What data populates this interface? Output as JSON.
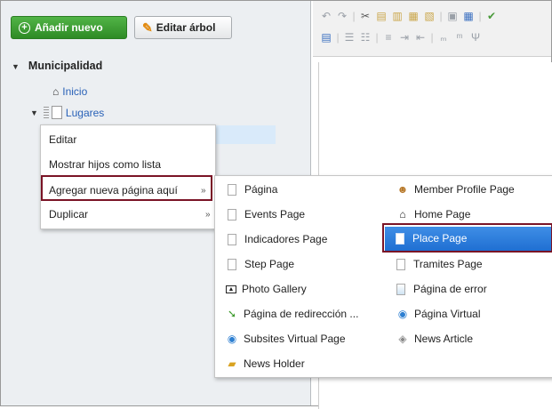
{
  "toolbar": {
    "add_label": "Añadir nuevo",
    "edit_tree_label": "Editar árbol"
  },
  "tree": {
    "root": "Municipalidad",
    "inicio": "Inicio",
    "lugares": "Lugares"
  },
  "context_menu": {
    "items": [
      {
        "label": "Editar",
        "submenu": false
      },
      {
        "label": "Mostrar hijos como lista",
        "submenu": false
      },
      {
        "label": "Agregar nueva página aquí",
        "submenu": true
      },
      {
        "label": "Duplicar",
        "submenu": true
      }
    ],
    "arrow": "»"
  },
  "submenu": {
    "col1": [
      {
        "label": "Página",
        "icon": "page-icon"
      },
      {
        "label": "Events Page",
        "icon": "page-icon"
      },
      {
        "label": "Indicadores Page",
        "icon": "page-icon"
      },
      {
        "label": "Step Page",
        "icon": "page-icon"
      },
      {
        "label": "Photo Gallery",
        "icon": "photo-icon"
      },
      {
        "label": "Página de redirección ...",
        "icon": "redirect-icon"
      },
      {
        "label": "Subsites Virtual Page",
        "icon": "virtual-page-icon"
      },
      {
        "label": "News Holder",
        "icon": "folder-icon"
      }
    ],
    "col2": [
      {
        "label": "Member Profile Page",
        "icon": "member-icon"
      },
      {
        "label": "Home Page",
        "icon": "home-icon"
      },
      {
        "label": "Place Page",
        "icon": "page-icon",
        "selected": true
      },
      {
        "label": "Tramites Page",
        "icon": "page-icon"
      },
      {
        "label": "Página de error",
        "icon": "error-page-icon"
      },
      {
        "label": "Página Virtual",
        "icon": "virtual-page-icon"
      },
      {
        "label": "News Article",
        "icon": "tag-icon"
      }
    ]
  },
  "colors": {
    "accent_green": "#2e8b25",
    "link_blue": "#2a62b8",
    "highlight_border": "#7a1426",
    "selected_blue": "#1f6fd2"
  }
}
